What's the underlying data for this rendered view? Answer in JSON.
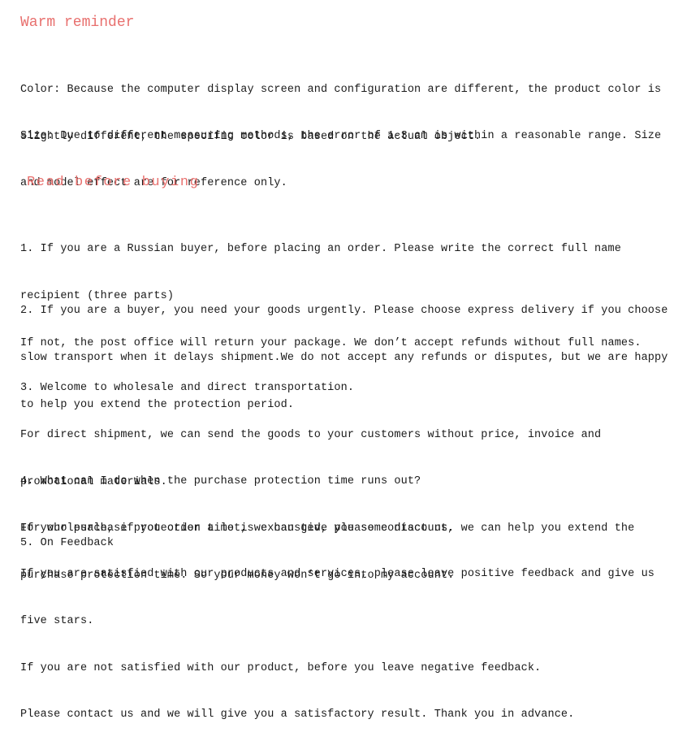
{
  "colors": {
    "heading": "#e8706e",
    "body": "#1a1a1a",
    "background": "#ffffff"
  },
  "sections": {
    "warm_reminder": {
      "heading": "Warm reminder",
      "color_note": {
        "line1": "Color: Because the computer display screen and configuration are different, the product color is",
        "line2": "slightly different, the specific color is based on the actual object."
      },
      "size_note": {
        "line1": "Size: Due to different measuring methods, the error of 1-3 cm is within a reasonable range. Size",
        "line2": "and model effect are for reference only."
      }
    },
    "read_before_buying": {
      "heading": "Read before buying",
      "item1": {
        "line1": "1. If you are a Russian buyer, before placing an order. Please write the correct full name",
        "line2": "recipient (three parts)",
        "line3": "If not, the post office will return your package. We don’t accept refunds without full names."
      },
      "item2": {
        "line1": "2. If you are a buyer, you need your goods urgently. Please choose express delivery if you choose",
        "line2": "slow transport when it delays shipment.We do not accept any refunds or disputes, but we are happy",
        "line3": "to help you extend the protection period."
      },
      "item3": {
        "line1": "3. Welcome to wholesale and direct transportation.",
        "line2": "For direct shipment, we can send the goods to your customers without price, invoice and",
        "line3": "promotional materials.",
        "line4": "For wholesale, if you order a lot, we can give you some discount."
      },
      "item4": {
        "line1": "4. What can I do when the purchase protection time runs out?",
        "line2": "If your purchase protection time is exhausted, please contact us, we can help you extend the",
        "line3": "purchase protection time. So your money won’t go into my account."
      },
      "item5": {
        "heading": "5. On Feedback",
        "line1": "If you are satisfied with our products and services, please leave positive feedback and give us",
        "line2": "five stars.",
        "line3": "If you are not satisfied with our product, before you leave negative feedback.",
        "line4": "Please contact us and we will give you a satisfactory result. Thank you in advance."
      }
    }
  }
}
